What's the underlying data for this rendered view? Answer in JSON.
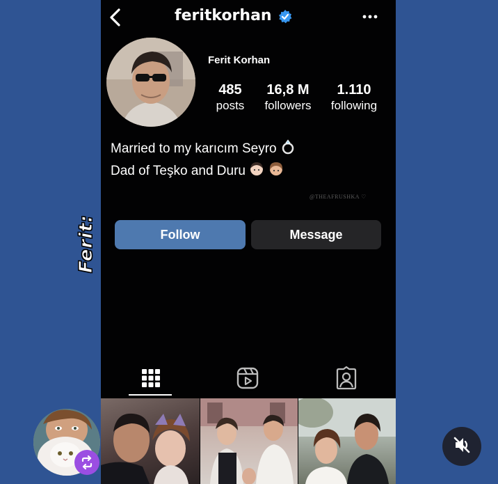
{
  "overlay": {
    "side_label": "Ferit:"
  },
  "profile": {
    "username": "feritkorhan",
    "display_name": "Ferit Korhan",
    "stats": [
      {
        "value": "485",
        "label": "posts"
      },
      {
        "value": "16,8 M",
        "label": "followers"
      },
      {
        "value": "1.110",
        "label": "following"
      }
    ],
    "bio": {
      "line1": "Married to my karıcım Seyro",
      "line2": "Dad of Teşko and Duru"
    },
    "watermark": "@THEAFRUSHKA ♡"
  },
  "actions": {
    "follow_label": "Follow",
    "message_label": "Message"
  },
  "tabs": [
    {
      "icon": "grid-icon",
      "active": true
    },
    {
      "icon": "reels-icon",
      "active": false
    },
    {
      "icon": "tagged-icon",
      "active": false
    }
  ],
  "colors": {
    "background": "#2f5493",
    "follow_button": "#4e79af",
    "message_button": "#252527",
    "verified": "#3897f0",
    "repost_badge": "#9b4ee2"
  }
}
